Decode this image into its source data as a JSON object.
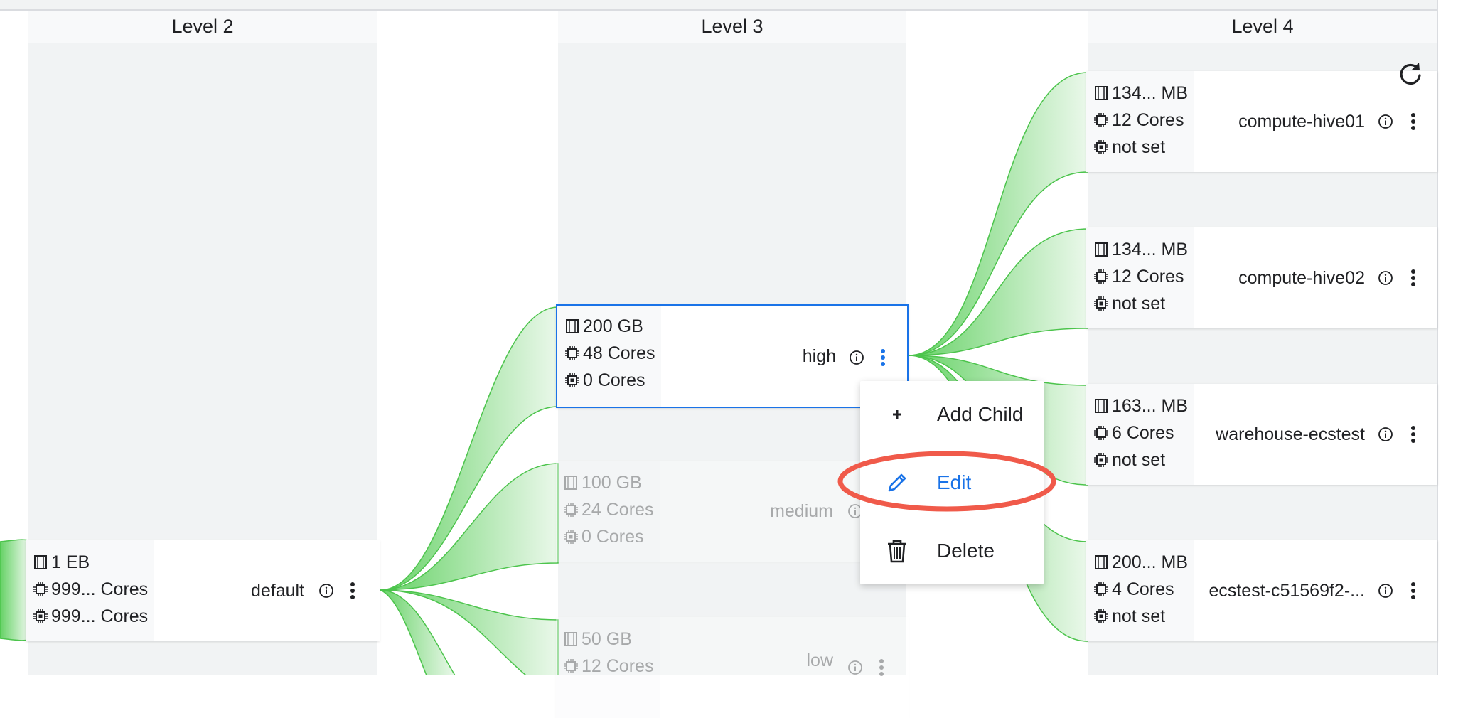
{
  "columns": [
    {
      "label": "Level 2"
    },
    {
      "label": "Level 3"
    },
    {
      "label": "Level 4"
    }
  ],
  "nodes": {
    "default": {
      "memory": "1 EB",
      "vcores": "999... Cores",
      "gpu": "999... Cores",
      "name": "default"
    },
    "high": {
      "memory": "200 GB",
      "vcores": "48 Cores",
      "gpu": "0 Cores",
      "name": "high"
    },
    "medium": {
      "memory": "100 GB",
      "vcores": "24 Cores",
      "gpu": "0 Cores",
      "name": "medium"
    },
    "low": {
      "memory": "50 GB",
      "vcores": "12 Cores",
      "name": "low"
    },
    "hive01": {
      "memory": "134... MB",
      "vcores": "12 Cores",
      "gpu": "not set",
      "name": "compute-hive01"
    },
    "hive02": {
      "memory": "134... MB",
      "vcores": "12 Cores",
      "gpu": "not set",
      "name": "compute-hive02"
    },
    "warehouse": {
      "memory": "163... MB",
      "vcores": "6 Cores",
      "gpu": "not set",
      "name": "warehouse-ecstest"
    },
    "ecstest": {
      "memory": "200... MB",
      "vcores": "4 Cores",
      "gpu": "not set",
      "name": "ecstest-c51569f2-..."
    }
  },
  "menu": {
    "add_child": "Add Child",
    "edit": "Edit",
    "delete": "Delete"
  },
  "colors": {
    "accent": "#1a73e8",
    "link_green": "#5ccf5c",
    "highlight": "#f05a4a"
  },
  "icons": [
    "memory-icon",
    "cpu-icon",
    "gpu-icon",
    "info-icon",
    "more-vert-icon",
    "refresh-icon",
    "plus-icon",
    "pencil-icon",
    "trash-icon"
  ]
}
